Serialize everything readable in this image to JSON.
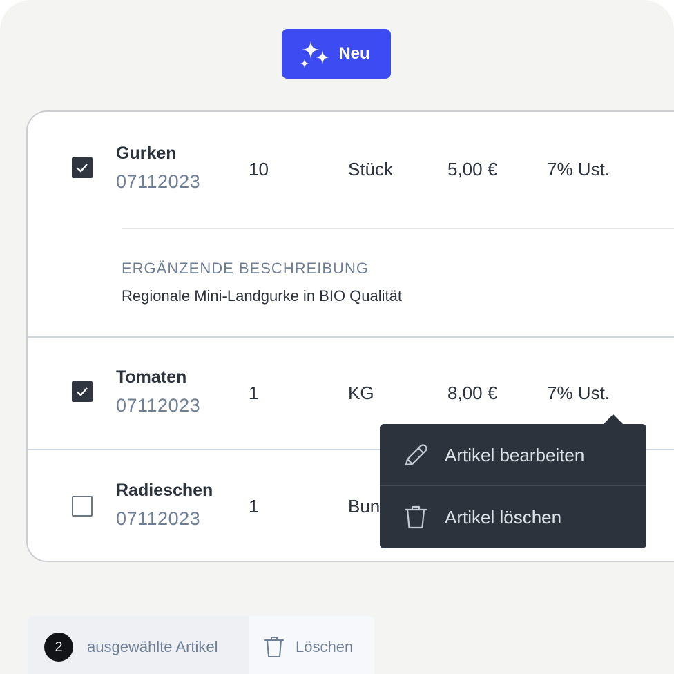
{
  "toolbar": {
    "new_label": "Neu"
  },
  "rows": [
    {
      "name": "Gurken",
      "code": "07112023",
      "qty": "10",
      "unit": "Stück",
      "price": "5,00 €",
      "tax": "7% Ust.",
      "checked": true,
      "description_label": "ERGÄNZENDE BESCHREIBUNG",
      "description": "Regionale Mini-Landgurke in BIO Qualität"
    },
    {
      "name": "Tomaten",
      "code": "07112023",
      "qty": "1",
      "unit": "KG",
      "price": "8,00 €",
      "tax": "7% Ust.",
      "checked": true
    },
    {
      "name": "Radieschen",
      "code": "07112023",
      "qty": "1",
      "unit": "Bun",
      "checked": false
    }
  ],
  "context_menu": {
    "items": [
      {
        "label": "Artikel bearbeiten",
        "icon": "pencil-icon"
      },
      {
        "label": "Artikel löschen",
        "icon": "trash-icon"
      }
    ]
  },
  "footer": {
    "count": "2",
    "selected_label": "ausgewählte Artikel",
    "delete_label": "Löschen"
  },
  "colors": {
    "accent": "#3d4cf2",
    "dark": "#2d333d",
    "muted": "#6e7e93"
  }
}
